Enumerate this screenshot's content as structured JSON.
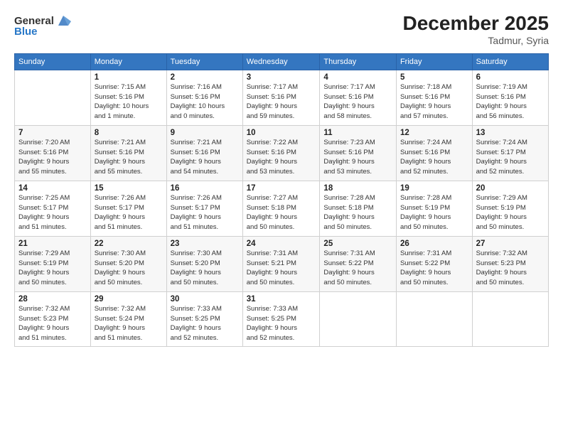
{
  "header": {
    "logo_general": "General",
    "logo_blue": "Blue",
    "month": "December 2025",
    "location": "Tadmur, Syria"
  },
  "weekdays": [
    "Sunday",
    "Monday",
    "Tuesday",
    "Wednesday",
    "Thursday",
    "Friday",
    "Saturday"
  ],
  "weeks": [
    [
      {
        "day": "",
        "info": ""
      },
      {
        "day": "1",
        "info": "Sunrise: 7:15 AM\nSunset: 5:16 PM\nDaylight: 10 hours\nand 1 minute."
      },
      {
        "day": "2",
        "info": "Sunrise: 7:16 AM\nSunset: 5:16 PM\nDaylight: 10 hours\nand 0 minutes."
      },
      {
        "day": "3",
        "info": "Sunrise: 7:17 AM\nSunset: 5:16 PM\nDaylight: 9 hours\nand 59 minutes."
      },
      {
        "day": "4",
        "info": "Sunrise: 7:17 AM\nSunset: 5:16 PM\nDaylight: 9 hours\nand 58 minutes."
      },
      {
        "day": "5",
        "info": "Sunrise: 7:18 AM\nSunset: 5:16 PM\nDaylight: 9 hours\nand 57 minutes."
      },
      {
        "day": "6",
        "info": "Sunrise: 7:19 AM\nSunset: 5:16 PM\nDaylight: 9 hours\nand 56 minutes."
      }
    ],
    [
      {
        "day": "7",
        "info": "Sunrise: 7:20 AM\nSunset: 5:16 PM\nDaylight: 9 hours\nand 55 minutes."
      },
      {
        "day": "8",
        "info": "Sunrise: 7:21 AM\nSunset: 5:16 PM\nDaylight: 9 hours\nand 55 minutes."
      },
      {
        "day": "9",
        "info": "Sunrise: 7:21 AM\nSunset: 5:16 PM\nDaylight: 9 hours\nand 54 minutes."
      },
      {
        "day": "10",
        "info": "Sunrise: 7:22 AM\nSunset: 5:16 PM\nDaylight: 9 hours\nand 53 minutes."
      },
      {
        "day": "11",
        "info": "Sunrise: 7:23 AM\nSunset: 5:16 PM\nDaylight: 9 hours\nand 53 minutes."
      },
      {
        "day": "12",
        "info": "Sunrise: 7:24 AM\nSunset: 5:16 PM\nDaylight: 9 hours\nand 52 minutes."
      },
      {
        "day": "13",
        "info": "Sunrise: 7:24 AM\nSunset: 5:17 PM\nDaylight: 9 hours\nand 52 minutes."
      }
    ],
    [
      {
        "day": "14",
        "info": "Sunrise: 7:25 AM\nSunset: 5:17 PM\nDaylight: 9 hours\nand 51 minutes."
      },
      {
        "day": "15",
        "info": "Sunrise: 7:26 AM\nSunset: 5:17 PM\nDaylight: 9 hours\nand 51 minutes."
      },
      {
        "day": "16",
        "info": "Sunrise: 7:26 AM\nSunset: 5:17 PM\nDaylight: 9 hours\nand 51 minutes."
      },
      {
        "day": "17",
        "info": "Sunrise: 7:27 AM\nSunset: 5:18 PM\nDaylight: 9 hours\nand 50 minutes."
      },
      {
        "day": "18",
        "info": "Sunrise: 7:28 AM\nSunset: 5:18 PM\nDaylight: 9 hours\nand 50 minutes."
      },
      {
        "day": "19",
        "info": "Sunrise: 7:28 AM\nSunset: 5:19 PM\nDaylight: 9 hours\nand 50 minutes."
      },
      {
        "day": "20",
        "info": "Sunrise: 7:29 AM\nSunset: 5:19 PM\nDaylight: 9 hours\nand 50 minutes."
      }
    ],
    [
      {
        "day": "21",
        "info": "Sunrise: 7:29 AM\nSunset: 5:19 PM\nDaylight: 9 hours\nand 50 minutes."
      },
      {
        "day": "22",
        "info": "Sunrise: 7:30 AM\nSunset: 5:20 PM\nDaylight: 9 hours\nand 50 minutes."
      },
      {
        "day": "23",
        "info": "Sunrise: 7:30 AM\nSunset: 5:20 PM\nDaylight: 9 hours\nand 50 minutes."
      },
      {
        "day": "24",
        "info": "Sunrise: 7:31 AM\nSunset: 5:21 PM\nDaylight: 9 hours\nand 50 minutes."
      },
      {
        "day": "25",
        "info": "Sunrise: 7:31 AM\nSunset: 5:22 PM\nDaylight: 9 hours\nand 50 minutes."
      },
      {
        "day": "26",
        "info": "Sunrise: 7:31 AM\nSunset: 5:22 PM\nDaylight: 9 hours\nand 50 minutes."
      },
      {
        "day": "27",
        "info": "Sunrise: 7:32 AM\nSunset: 5:23 PM\nDaylight: 9 hours\nand 50 minutes."
      }
    ],
    [
      {
        "day": "28",
        "info": "Sunrise: 7:32 AM\nSunset: 5:23 PM\nDaylight: 9 hours\nand 51 minutes."
      },
      {
        "day": "29",
        "info": "Sunrise: 7:32 AM\nSunset: 5:24 PM\nDaylight: 9 hours\nand 51 minutes."
      },
      {
        "day": "30",
        "info": "Sunrise: 7:33 AM\nSunset: 5:25 PM\nDaylight: 9 hours\nand 52 minutes."
      },
      {
        "day": "31",
        "info": "Sunrise: 7:33 AM\nSunset: 5:25 PM\nDaylight: 9 hours\nand 52 minutes."
      },
      {
        "day": "",
        "info": ""
      },
      {
        "day": "",
        "info": ""
      },
      {
        "day": "",
        "info": ""
      }
    ]
  ]
}
